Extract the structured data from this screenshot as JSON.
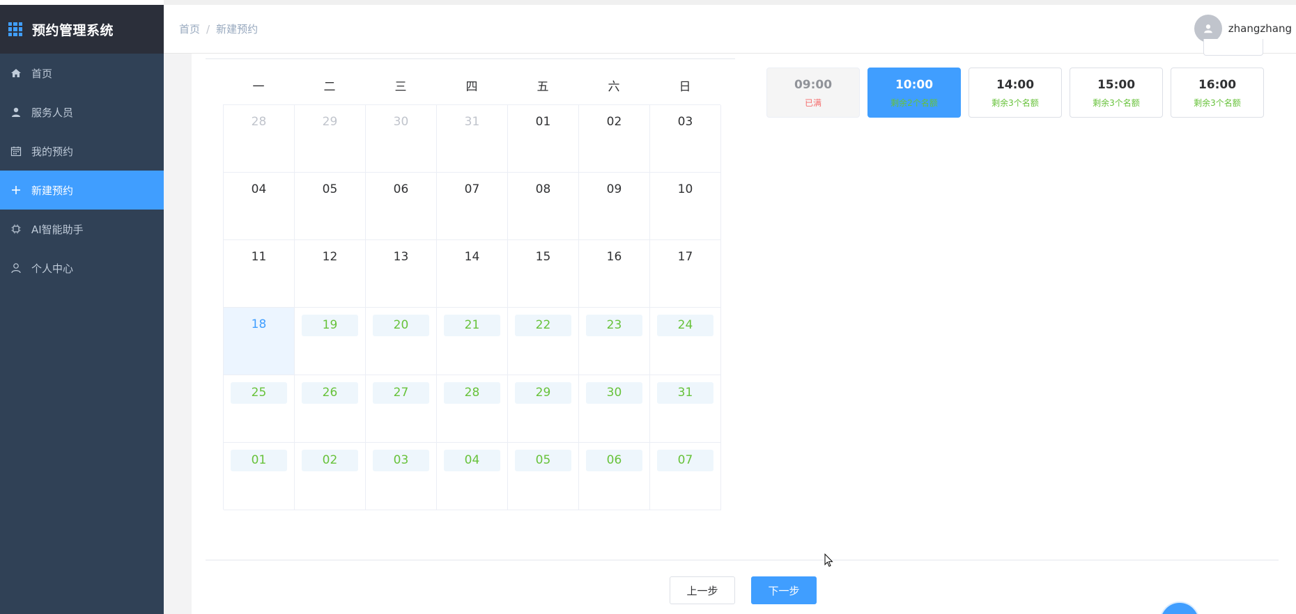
{
  "app": {
    "title": "预约管理系统"
  },
  "sidebar": {
    "items": [
      {
        "label": "首页",
        "icon": "home-icon",
        "active": false
      },
      {
        "label": "服务人员",
        "icon": "user-icon",
        "active": false
      },
      {
        "label": "我的预约",
        "icon": "calendar-icon",
        "active": false
      },
      {
        "label": "新建预约",
        "icon": "plus-icon",
        "active": true
      },
      {
        "label": "AI智能助手",
        "icon": "chip-icon",
        "active": false
      },
      {
        "label": "个人中心",
        "icon": "person-icon",
        "active": false
      }
    ]
  },
  "header": {
    "breadcrumb": [
      "首页",
      "新建预约"
    ],
    "breadcrumb_sep": "/",
    "username": "zhangzhang"
  },
  "calendar": {
    "weekdays": [
      "一",
      "二",
      "三",
      "四",
      "五",
      "六",
      "日"
    ],
    "weeks": [
      [
        {
          "d": "28",
          "s": "other"
        },
        {
          "d": "29",
          "s": "other"
        },
        {
          "d": "30",
          "s": "other"
        },
        {
          "d": "31",
          "s": "other"
        },
        {
          "d": "01",
          "s": "normal"
        },
        {
          "d": "02",
          "s": "normal"
        },
        {
          "d": "03",
          "s": "normal"
        }
      ],
      [
        {
          "d": "04",
          "s": "normal"
        },
        {
          "d": "05",
          "s": "normal"
        },
        {
          "d": "06",
          "s": "normal"
        },
        {
          "d": "07",
          "s": "normal"
        },
        {
          "d": "08",
          "s": "normal"
        },
        {
          "d": "09",
          "s": "normal"
        },
        {
          "d": "10",
          "s": "normal"
        }
      ],
      [
        {
          "d": "11",
          "s": "normal"
        },
        {
          "d": "12",
          "s": "normal"
        },
        {
          "d": "13",
          "s": "normal"
        },
        {
          "d": "14",
          "s": "normal"
        },
        {
          "d": "15",
          "s": "normal"
        },
        {
          "d": "16",
          "s": "normal"
        },
        {
          "d": "17",
          "s": "normal"
        }
      ],
      [
        {
          "d": "18",
          "s": "today"
        },
        {
          "d": "19",
          "s": "avail"
        },
        {
          "d": "20",
          "s": "avail"
        },
        {
          "d": "21",
          "s": "avail"
        },
        {
          "d": "22",
          "s": "avail"
        },
        {
          "d": "23",
          "s": "avail"
        },
        {
          "d": "24",
          "s": "avail"
        }
      ],
      [
        {
          "d": "25",
          "s": "avail"
        },
        {
          "d": "26",
          "s": "avail"
        },
        {
          "d": "27",
          "s": "avail"
        },
        {
          "d": "28",
          "s": "avail"
        },
        {
          "d": "29",
          "s": "avail"
        },
        {
          "d": "30",
          "s": "avail"
        },
        {
          "d": "31",
          "s": "avail"
        }
      ],
      [
        {
          "d": "01",
          "s": "avail"
        },
        {
          "d": "02",
          "s": "avail"
        },
        {
          "d": "03",
          "s": "avail"
        },
        {
          "d": "04",
          "s": "avail"
        },
        {
          "d": "05",
          "s": "avail"
        },
        {
          "d": "06",
          "s": "avail"
        },
        {
          "d": "07",
          "s": "avail"
        }
      ]
    ]
  },
  "time_slots": [
    {
      "time": "09:00",
      "status": "已满",
      "state": "full"
    },
    {
      "time": "10:00",
      "status": "剩余2个名额",
      "state": "selected"
    },
    {
      "time": "14:00",
      "status": "剩余3个名额",
      "state": "available"
    },
    {
      "time": "15:00",
      "status": "剩余3个名额",
      "state": "available"
    },
    {
      "time": "16:00",
      "status": "剩余3个名额",
      "state": "available"
    }
  ],
  "footer": {
    "prev_label": "上一步",
    "next_label": "下一步"
  },
  "colors": {
    "sidebar_bg": "#304156",
    "accent": "#409eff",
    "available": "#67c23a",
    "full": "#f56c6c"
  }
}
